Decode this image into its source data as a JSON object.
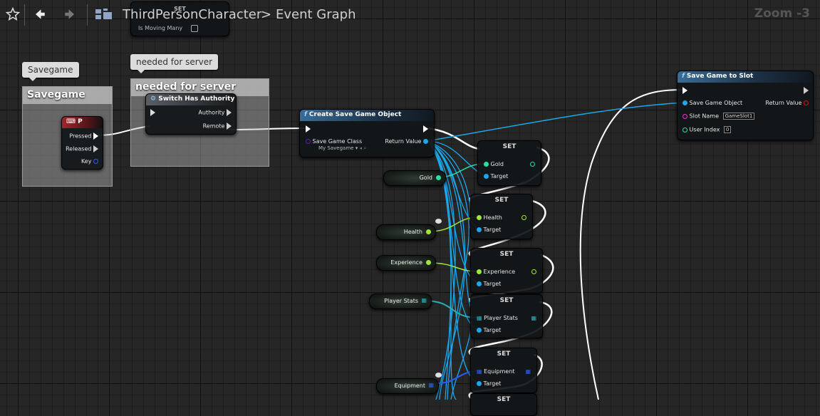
{
  "toolbar": {
    "breadcrumb_blueprint": "ThirdPersonCharacter",
    "breadcrumb_separator": ">",
    "breadcrumb_graph": "Event Graph",
    "zoom": "Zoom -3"
  },
  "icons": {
    "favorite": "star-outline",
    "back": "left-arrow",
    "forward": "right-arrow",
    "graph": "blueprint-grid"
  },
  "bg_node": {
    "title": "SET",
    "pin": "Is Moving Many"
  },
  "comments": {
    "savegame": {
      "bubble": "Savegame",
      "title": "Savegame"
    },
    "server": {
      "bubble": "needed for server",
      "title": "needed for server"
    }
  },
  "key_node": {
    "title": "P",
    "pressed": "Pressed",
    "released": "Released",
    "key": "Key"
  },
  "authority_node": {
    "title": "Switch Has Authority",
    "authority": "Authority",
    "remote": "Remote"
  },
  "create_node": {
    "title": "Create Save Game Object",
    "class_label": "Save Game Class",
    "class_value": "My Savegame",
    "return_value": "Return Value"
  },
  "save_node": {
    "title": "Save Game to Slot",
    "object": "Save Game Object",
    "return_value": "Return Value",
    "slot_name": "Slot Name",
    "slot_value": "GameSlot1",
    "user_index": "User Index",
    "user_index_value": "0"
  },
  "set_nodes": [
    {
      "title": "SET",
      "var": "Gold",
      "target": "Target"
    },
    {
      "title": "SET",
      "var": "Health",
      "target": "Target"
    },
    {
      "title": "SET",
      "var": "Experience",
      "target": "Target"
    },
    {
      "title": "SET",
      "var": "Player Stats",
      "target": "Target"
    },
    {
      "title": "SET",
      "var": "Equipment",
      "target": "Target"
    },
    {
      "title": "SET"
    }
  ],
  "variables": [
    "Gold",
    "Health",
    "Experience",
    "Player Stats",
    "Equipment"
  ],
  "colors": {
    "exec": "#ffffff",
    "object_pin": "#1aa7ec",
    "int_pin": "#27e0a2",
    "float_pin": "#9ee83a",
    "struct_pin": "#25b0b5",
    "array_pin": "#2a5ff0",
    "string_pin": "#e330d0",
    "class_pin": "#5b1bd1"
  }
}
